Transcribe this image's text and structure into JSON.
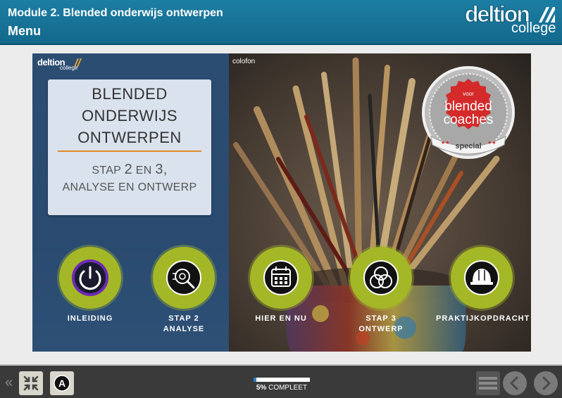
{
  "header": {
    "module_title": "Module 2. Blended onderwijs ontwerpen",
    "menu_title": "Menu",
    "logo_top": "deltion",
    "logo_bottom": "college"
  },
  "stage": {
    "mini_logo_top": "deltion",
    "mini_logo_bottom": "college",
    "title_lines": [
      "BLENDED",
      "ONDERWIJS",
      "ONTWERPEN"
    ],
    "subtitle_line1_a": "STAP ",
    "subtitle_line1_b": "2",
    "subtitle_line1_c": " EN ",
    "subtitle_line1_d": "3,",
    "subtitle_line2": "ANALYSE EN ONTWERP",
    "colofon": "colofon",
    "badge": {
      "top": "voor",
      "line1": "blended",
      "line2": "coaches",
      "ribbon": "special"
    },
    "nav": [
      {
        "label": "INLEIDING",
        "icon": "power-icon"
      },
      {
        "label": "STAP 2",
        "label2": "ANALYSE",
        "icon": "magnifier-icon"
      },
      {
        "label": "HIER EN NU",
        "icon": "calendar-icon"
      },
      {
        "label": "STAP 3",
        "label2": "ONTWERP",
        "icon": "venn-icon"
      },
      {
        "label": "PRAKTIJKOPDRACHT",
        "icon": "hardhat-icon"
      }
    ]
  },
  "footer": {
    "progress_percent": 5,
    "progress_value": "5%",
    "progress_text": " COMPLEET",
    "accessibility_letter": "A"
  },
  "colors": {
    "header_blue": "#1d7ea3",
    "left_panel": "#2c4d72",
    "nav_green": "#a4b726",
    "badge_red": "#d42a2a",
    "rule_orange": "#e28a2b",
    "progress_blue": "#2a80c8"
  }
}
